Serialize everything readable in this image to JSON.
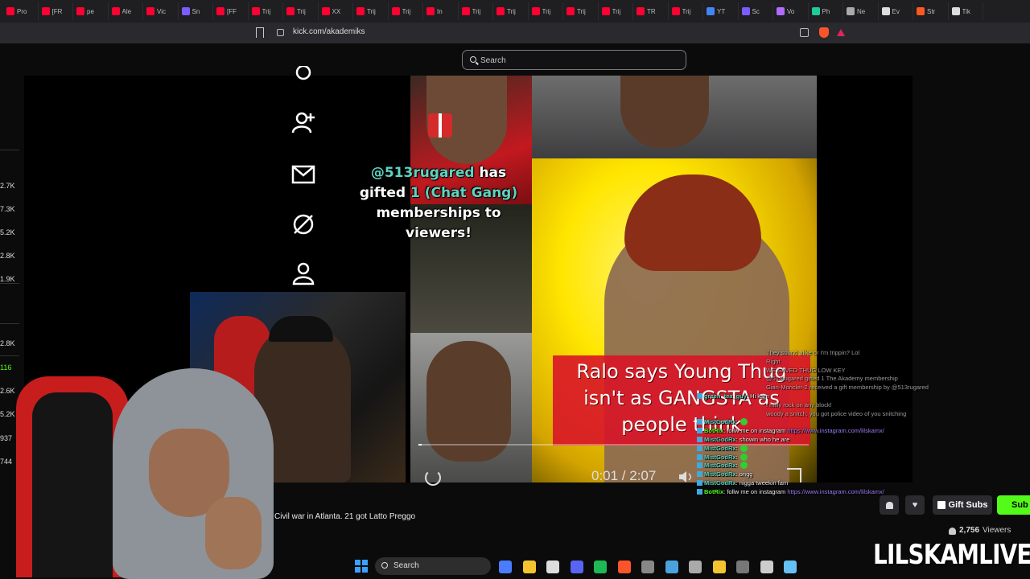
{
  "browser": {
    "tabs": [
      {
        "label": "Pro",
        "color": "#ff0033"
      },
      {
        "label": "[FR",
        "color": "#ff0033"
      },
      {
        "label": "pe",
        "color": "#ff0033"
      },
      {
        "label": "Ale",
        "color": "#ff0033"
      },
      {
        "label": "Vic",
        "color": "#ff0033"
      },
      {
        "label": "Sn",
        "color": "#7b5cff"
      },
      {
        "label": "[FF",
        "color": "#ff0033"
      },
      {
        "label": "Trij",
        "color": "#ff0033"
      },
      {
        "label": "Trij",
        "color": "#ff0033"
      },
      {
        "label": "XX",
        "color": "#ff0033"
      },
      {
        "label": "Trij",
        "color": "#ff0033"
      },
      {
        "label": "Trij",
        "color": "#ff0033"
      },
      {
        "label": "In",
        "color": "#ff0033"
      },
      {
        "label": "Trij",
        "color": "#ff0033"
      },
      {
        "label": "Trij",
        "color": "#ff0033"
      },
      {
        "label": "Trij",
        "color": "#ff0033"
      },
      {
        "label": "Trij",
        "color": "#ff0033"
      },
      {
        "label": "Trij",
        "color": "#ff0033"
      },
      {
        "label": "TR",
        "color": "#ff0033"
      },
      {
        "label": "Trij",
        "color": "#ff0033"
      },
      {
        "label": "YT",
        "color": "#4285f4"
      },
      {
        "label": "Sc",
        "color": "#7b5cff"
      },
      {
        "label": "Vo",
        "color": "#b06cff"
      },
      {
        "label": "Ph",
        "color": "#20c997"
      },
      {
        "label": "Ne",
        "color": "#aaaaaa"
      },
      {
        "label": "Ev",
        "color": "#dddddd"
      },
      {
        "label": "Str",
        "color": "#ff5722"
      },
      {
        "label": "Tik",
        "color": "#dddddd"
      }
    ],
    "url": "kick.com/akademiks"
  },
  "search": {
    "placeholder": "Search"
  },
  "stats": [
    {
      "value": "2.7K",
      "color": "#dddddd"
    },
    {
      "value": "7.3K",
      "color": "#dddddd"
    },
    {
      "value": "5.2K",
      "color": "#dddddd"
    },
    {
      "value": "2.8K",
      "color": "#dddddd"
    },
    {
      "value": "1.9K",
      "color": "#dddddd"
    },
    {
      "value": "2.8K",
      "color": "#dddddd"
    },
    {
      "value": "116",
      "color": "#53fc18"
    },
    {
      "value": "2.6K",
      "color": "#dddddd"
    },
    {
      "value": "5.2K",
      "color": "#dddddd"
    },
    {
      "value": "937",
      "color": "#dddddd"
    },
    {
      "value": "744",
      "color": "#dddddd"
    }
  ],
  "video": {
    "gift_mention": "@513rugared",
    "gift_mid": "has gifted",
    "gift_count": "1",
    "gift_tier": "(Chat Gang)",
    "gift_tail": "memberships to viewers!",
    "caption": "Ralo says Young Thug isn't as GANGSTA as people think",
    "time": "0:01 / 2:07",
    "progress": 0.008
  },
  "page_text": "Civil war in Atlanta. 21 got Latto Preggo",
  "chat": [
    {
      "user": "",
      "text": "They sound alike or I'm trippin? Lol",
      "faint": true
    },
    {
      "user": "",
      "text": "Right",
      "faint": true
    },
    {
      "user": "",
      "text": "WE SAVED THUG LOW KEY",
      "faint": true
    },
    {
      "user": "",
      "text": "@513rugared gifted 1 The Akademy membership",
      "faint": true
    },
    {
      "user": "",
      "text": "Gian-Moncler-2 received a gift membership by @513rugared",
      "faint": true
    },
    {
      "user": "green_tea_guy",
      "text": ": Hi kam",
      "faint": false
    },
    {
      "user": "",
      "text": "I milly rock on any block!",
      "faint": true
    },
    {
      "user": "",
      "text": "woody a snitch, you got police video of you snitching",
      "faint": true
    },
    {
      "user": "MistGodRx",
      "text": ":",
      "faint": false
    },
    {
      "user": "BotRix",
      "text": ": follw me on instagram ",
      "link": "https://www.instagram.com/lilskamx/",
      "faint": false
    },
    {
      "user": "MistGodRx",
      "text": ": showin who he are",
      "faint": false
    },
    {
      "user": "MistGodRx",
      "text": ":",
      "faint": false
    },
    {
      "user": "MistGodRx",
      "text": ":",
      "faint": false
    },
    {
      "user": "MistGodRx",
      "text": ":",
      "faint": false
    },
    {
      "user": "MistGodRx",
      "text": ": ongg",
      "faint": false
    },
    {
      "user": "MistGodRx",
      "text": ": nigga tweekin fam",
      "faint": false
    },
    {
      "user": "BotRix",
      "text": ": follw me on instagram ",
      "link": "https://www.instagram.com/lilskamx/",
      "faint": false
    }
  ],
  "actions": {
    "gift_subs": "Gift Subs",
    "subscribe": "Sub",
    "viewers_count": "2,756",
    "viewers_label": "Viewers"
  },
  "taskbar": {
    "search_label": "Search",
    "apps": [
      {
        "name": "copilot",
        "color": "#4a7cff"
      },
      {
        "name": "file-explorer",
        "color": "#f4c430"
      },
      {
        "name": "store",
        "color": "#dddddd"
      },
      {
        "name": "discord",
        "color": "#5865f2"
      },
      {
        "name": "edge",
        "color": "#1db954"
      },
      {
        "name": "brave",
        "color": "#fb542b"
      },
      {
        "name": "obs",
        "color": "#888888"
      },
      {
        "name": "steam",
        "color": "#4aa3df"
      },
      {
        "name": "capture-card",
        "color": "#aaaaaa"
      },
      {
        "name": "maps",
        "color": "#f4c430"
      },
      {
        "name": "4k-tool",
        "color": "#777777"
      },
      {
        "name": "media",
        "color": "#cccccc"
      },
      {
        "name": "steam-2",
        "color": "#66c0f4"
      }
    ]
  },
  "watermark": "LILSKAMLIVE"
}
